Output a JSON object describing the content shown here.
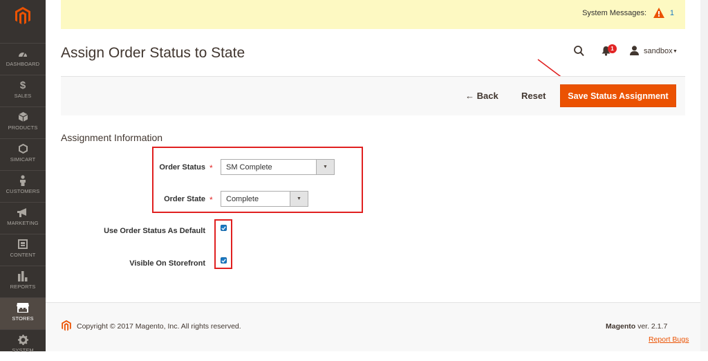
{
  "sidebar": {
    "items": [
      {
        "label": "DASHBOARD",
        "icon": "dashboard-icon"
      },
      {
        "label": "SALES",
        "icon": "dollar-icon"
      },
      {
        "label": "PRODUCTS",
        "icon": "cube-icon"
      },
      {
        "label": "SIMICART",
        "icon": "hexagon-icon"
      },
      {
        "label": "CUSTOMERS",
        "icon": "person-icon"
      },
      {
        "label": "MARKETING",
        "icon": "megaphone-icon"
      },
      {
        "label": "CONTENT",
        "icon": "layout-icon"
      },
      {
        "label": "REPORTS",
        "icon": "bar-chart-icon"
      },
      {
        "label": "STORES",
        "icon": "store-icon"
      },
      {
        "label": "SYSTEM",
        "icon": "gear-icon"
      }
    ]
  },
  "system_messages": {
    "label": "System Messages:",
    "count": "1"
  },
  "header": {
    "title": "Assign Order Status to State",
    "notification_count": "1",
    "username": "sandbox"
  },
  "actions": {
    "back": "← Back",
    "reset": "Reset",
    "save": "Save Status Assignment"
  },
  "form": {
    "section_title": "Assignment Information",
    "order_status_label": "Order Status",
    "order_status_value": "SM Complete",
    "order_state_label": "Order State",
    "order_state_value": "Complete",
    "use_default_label": "Use Order Status As Default",
    "use_default_checked": true,
    "visible_label": "Visible On Storefront",
    "visible_checked": true,
    "required_mark": "*"
  },
  "footer": {
    "copyright": "Copyright © 2017 Magento, Inc. All rights reserved.",
    "brand": "Magento",
    "version": " ver. 2.1.7",
    "report_bugs": "Report Bugs"
  },
  "colors": {
    "accent": "#eb5202",
    "sidebar": "#373330",
    "annotation": "#e02020"
  }
}
